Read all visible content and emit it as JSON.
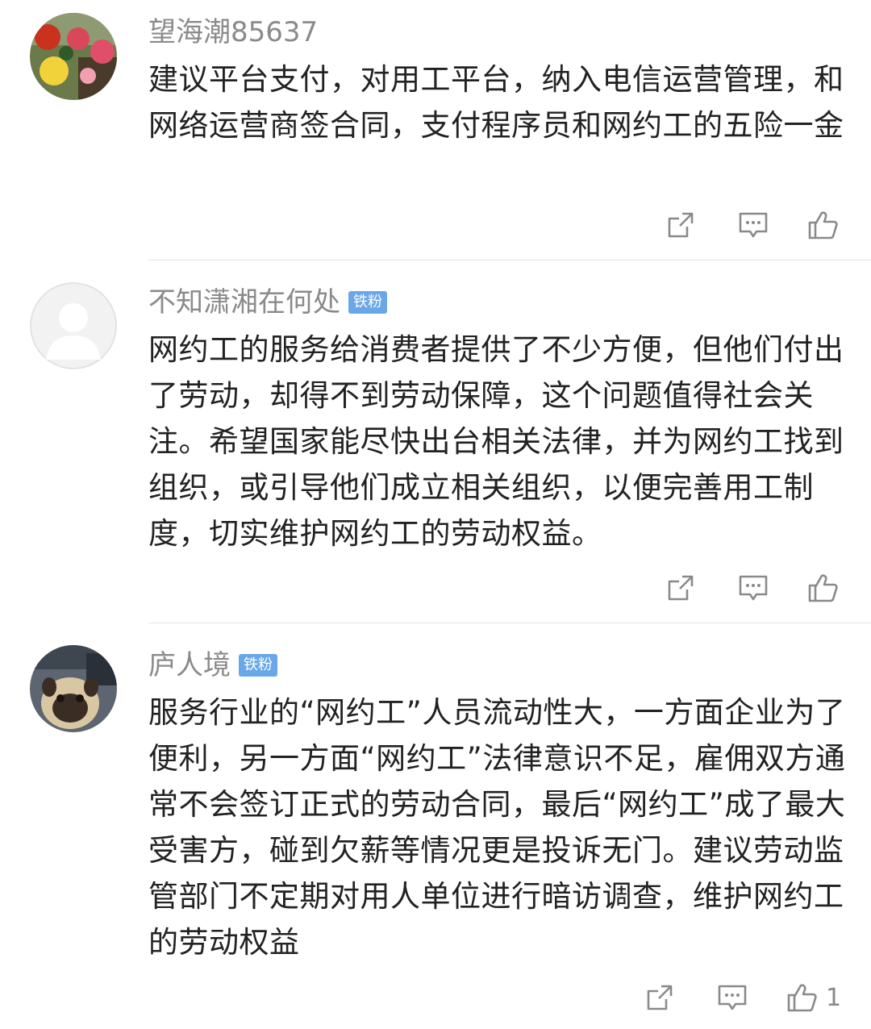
{
  "comments": [
    {
      "username": "望海潮85637",
      "badge": "",
      "text": "建议平台支付，对用工平台，纳入电信运营管理，和网络运营商签合同，支付程序员和网约工的五险一金",
      "like_count": ""
    },
    {
      "username": "不知潇湘在何处",
      "badge": "铁粉",
      "text": "网约工的服务给消费者提供了不少方便，但他们付出了劳动，却得不到劳动保障，这个问题值得社会关注。希望国家能尽快出台相关法律，并为网约工找到组织，或引导他们成立相关组织，以便完善用工制度，切实维护网约工的劳动权益。",
      "like_count": ""
    },
    {
      "username": "庐人境",
      "badge": "铁粉",
      "text": "服务行业的“网约工”人员流动性大，一方面企业为了便利，另一方面“网约工”法律意识不足，雇佣双方通常不会签订正式的劳动合同，最后“网约工”成了最大受害方，碰到欠薪等情况更是投诉无门。建议劳动监管部门不定期对用人单位进行暗访调查，维护网约工的劳动权益",
      "like_count": "1"
    }
  ],
  "icons": {
    "share": "share-icon",
    "reply": "comment-icon",
    "like": "thumbs-up-icon"
  },
  "colors": {
    "username": "#8a8a8a",
    "badge": "#6aa7e8",
    "text": "#222222",
    "divider": "#e3e3e3",
    "icon": "#8a8a8a"
  }
}
